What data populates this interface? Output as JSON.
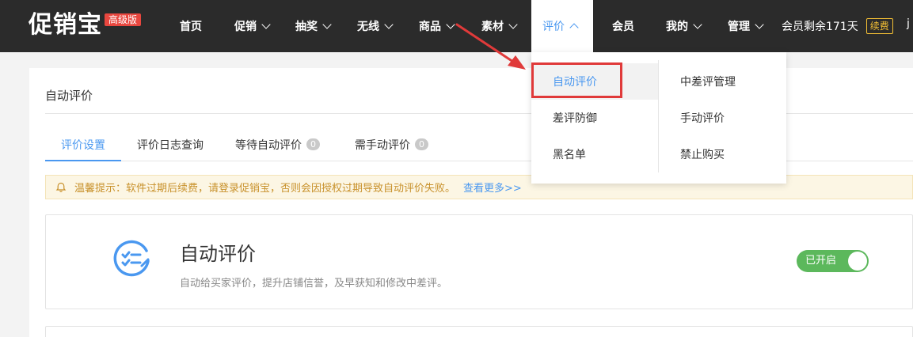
{
  "logo": {
    "text": "促销宝",
    "badge": "高级版"
  },
  "nav": {
    "items": [
      {
        "label": "首页",
        "has_menu": false
      },
      {
        "label": "促销",
        "has_menu": true
      },
      {
        "label": "抽奖",
        "has_menu": true
      },
      {
        "label": "无线",
        "has_menu": true
      },
      {
        "label": "商品",
        "has_menu": true
      },
      {
        "label": "素材",
        "has_menu": true
      },
      {
        "label": "评价",
        "has_menu": true,
        "active": true
      },
      {
        "label": "会员",
        "has_menu": false
      },
      {
        "label": "我的",
        "has_menu": true
      },
      {
        "label": "管理",
        "has_menu": true
      }
    ],
    "member_remaining": "会员剩余171天",
    "renew_label": "续费",
    "edge_char": "j"
  },
  "page": {
    "title": "自动评价",
    "tabs": [
      {
        "label": "评价设置",
        "active": true
      },
      {
        "label": "评价日志查询"
      },
      {
        "label": "等待自动评价",
        "count": "0"
      },
      {
        "label": "需手动评价",
        "count": "0"
      }
    ],
    "notice": {
      "text": "温馨提示：软件过期后续费，请登录促销宝，否则会因授权过期导致自动评价失败。",
      "link": "查看更多>>"
    },
    "card": {
      "icon": "checklist-icon",
      "title": "自动评价",
      "desc": "自动给买家评价，提升店铺信誉，及早获知和修改中差评。",
      "toggle_label": "已开启",
      "toggle_on": true
    }
  },
  "dropdown": {
    "left": [
      "自动评价",
      "差评防御",
      "黑名单"
    ],
    "right": [
      "中差评管理",
      "手动评价",
      "禁止购买"
    ],
    "hovered": "自动评价"
  },
  "colors": {
    "topbar": "#2b2b2b",
    "accent": "#4a98f0",
    "badge": "#e8473f",
    "toggle_on": "#5cb85c",
    "annotation": "#e03a3a",
    "notice_text": "#c8912b"
  }
}
